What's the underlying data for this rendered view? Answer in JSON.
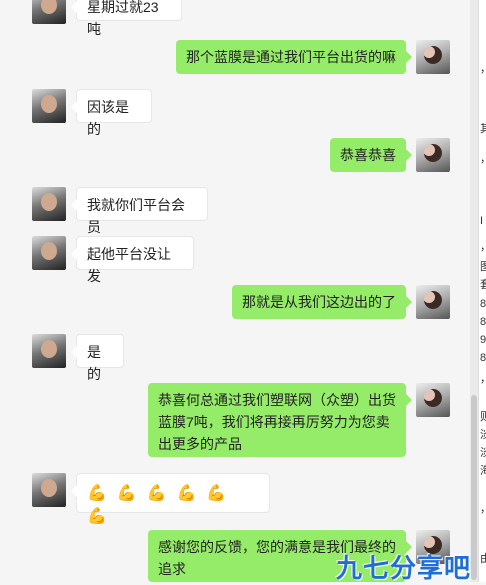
{
  "messages": [
    {
      "side": "in",
      "text": "星期过就23吨"
    },
    {
      "side": "out",
      "text": "那个蓝膜是通过我们平台出货的嘛"
    },
    {
      "side": "in",
      "text": "因该是的"
    },
    {
      "side": "out",
      "text": "恭喜恭喜"
    },
    {
      "side": "in",
      "text": "我就你们平台会员"
    },
    {
      "side": "in",
      "text": "起他平台没让发"
    },
    {
      "side": "out",
      "text": "那就是从我们这边出的了"
    },
    {
      "side": "in",
      "text": "是的"
    },
    {
      "side": "out",
      "text": "恭喜何总通过我们塑联网（众塑）出货蓝膜7吨，我们将再接再厉努力为您卖出更多的产品"
    },
    {
      "side": "in",
      "text": "",
      "emoji_icon": "strong-arm-emoji",
      "emoji_count": 6
    },
    {
      "side": "out",
      "text": "感谢您的反馈，您的满意是我们最终的追求"
    }
  ],
  "right_edge_text": [
    "，",
    "其",
    "，",
    "I",
    "，",
    "图",
    "套",
    "8",
    "8",
    "9",
    "8",
    "，",
    "则",
    "淡",
    "淡",
    "海",
    "，",
    "由"
  ],
  "watermark": "九七分享吧",
  "colors": {
    "outgoing_bubble": "#95ec69",
    "incoming_bubble": "#ffffff",
    "background": "#f5f5f5",
    "watermark": "#1f6fd2"
  }
}
